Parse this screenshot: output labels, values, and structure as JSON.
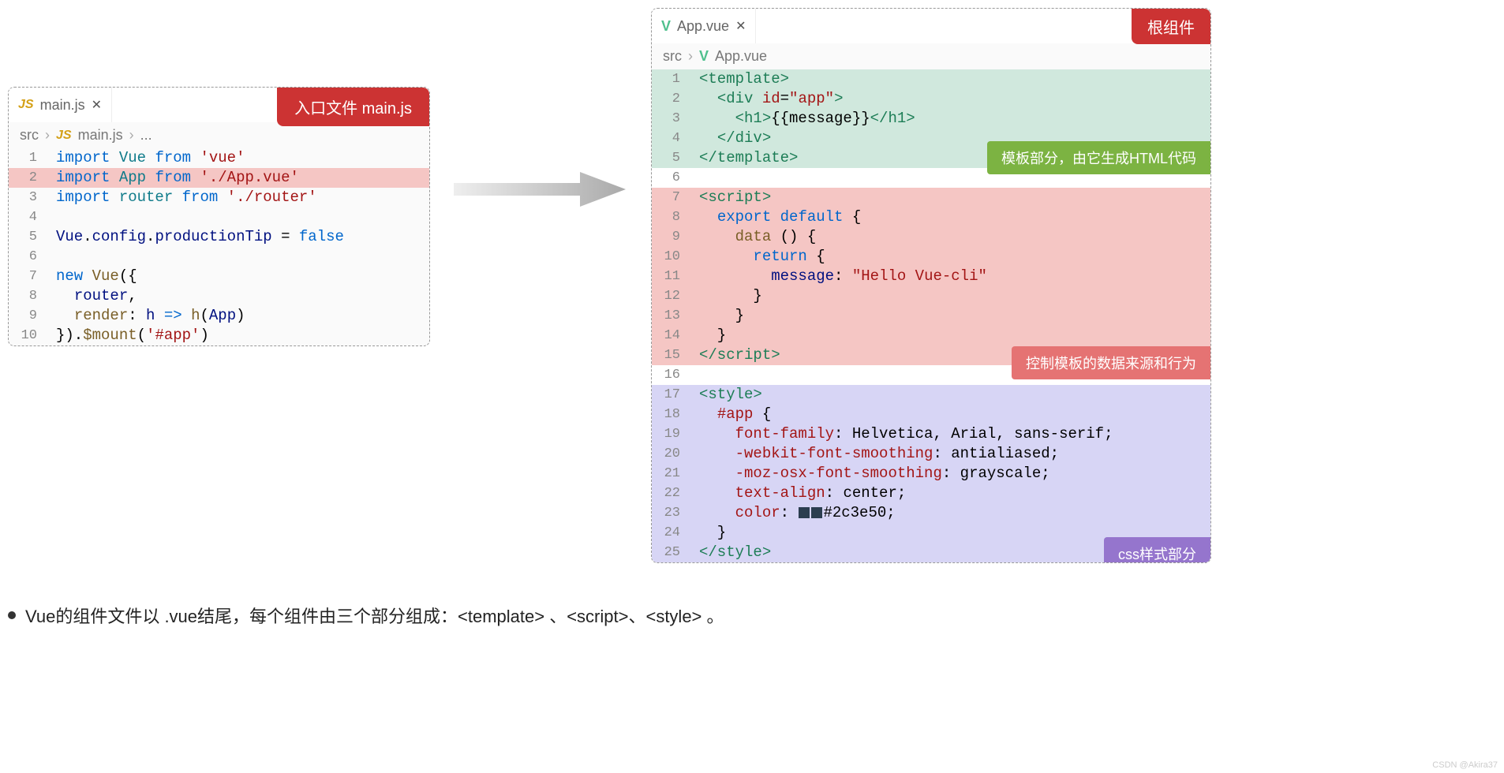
{
  "left": {
    "badge": "入口文件 main.js",
    "tab_name": "main.js",
    "tab_icon": "JS",
    "breadcrumb": {
      "seg1": "src",
      "seg2": "main.js",
      "seg3": "..."
    },
    "lines": [
      {
        "n": "1",
        "cls": "",
        "html": "<span class='kw'>import</span> <span class='var'>Vue</span> <span class='kw'>from</span> <span class='str'>'vue'</span>"
      },
      {
        "n": "2",
        "cls": "hl-highlight",
        "html": "<span class='kw'>import</span> <span class='var'>App</span> <span class='kw'>from</span> <span class='str'>'./App.vue'</span>"
      },
      {
        "n": "3",
        "cls": "",
        "html": "<span class='kw'>import</span> <span class='var'>router</span> <span class='kw'>from</span> <span class='str'>'./router'</span>"
      },
      {
        "n": "4",
        "cls": "",
        "html": ""
      },
      {
        "n": "5",
        "cls": "",
        "html": "<span class='ident'>Vue</span>.<span class='ident'>config</span>.<span class='ident'>productionTip</span> = <span class='kw'>false</span>"
      },
      {
        "n": "6",
        "cls": "",
        "html": ""
      },
      {
        "n": "7",
        "cls": "",
        "html": "<span class='kw'>new</span> <span class='fn'>Vue</span>({"
      },
      {
        "n": "8",
        "cls": "",
        "html": "  <span class='ident'>router</span>,"
      },
      {
        "n": "9",
        "cls": "",
        "html": "  <span class='fn'>render</span>: <span class='ident'>h</span> <span class='kw'>=&gt;</span> <span class='fn'>h</span>(<span class='ident'>App</span>)"
      },
      {
        "n": "10",
        "cls": "",
        "html": "}).<span class='fn'>$mount</span>(<span class='str'>'#app'</span>)"
      }
    ]
  },
  "right": {
    "badge": "根组件",
    "tab_name": "App.vue",
    "tab_icon": "V",
    "breadcrumb": {
      "seg1": "src",
      "seg2": "App.vue"
    },
    "labels": {
      "template": "模板部分，由它生成HTML代码",
      "script": "控制模板的数据来源和行为",
      "style": "css样式部分"
    },
    "lines": [
      {
        "n": "1",
        "cls": "hl-template",
        "html": "<span class='tag'>&lt;template&gt;</span>"
      },
      {
        "n": "2",
        "cls": "hl-template",
        "html": "  <span class='tag'>&lt;div</span> <span class='attr'>id</span>=<span class='str'>\"app\"</span><span class='tag'>&gt;</span>"
      },
      {
        "n": "3",
        "cls": "hl-template",
        "html": "    <span class='tag'>&lt;h1&gt;</span>{{message}}<span class='tag'>&lt;/h1&gt;</span>"
      },
      {
        "n": "4",
        "cls": "hl-template",
        "html": "  <span class='tag'>&lt;/div&gt;</span>"
      },
      {
        "n": "5",
        "cls": "hl-template",
        "html": "<span class='tag'>&lt;/template&gt;</span>"
      },
      {
        "n": "6",
        "cls": "hl-blank",
        "html": ""
      },
      {
        "n": "7",
        "cls": "hl-script",
        "html": "<span class='tag'>&lt;script&gt;</span>"
      },
      {
        "n": "8",
        "cls": "hl-script",
        "html": "  <span class='kw'>export</span> <span class='kw'>default</span> {"
      },
      {
        "n": "9",
        "cls": "hl-script",
        "html": "    <span class='fn'>data</span> () {"
      },
      {
        "n": "10",
        "cls": "hl-script",
        "html": "      <span class='kw'>return</span> {"
      },
      {
        "n": "11",
        "cls": "hl-script",
        "html": "        <span class='ident'>message</span>: <span class='str'>\"Hello Vue-cli\"</span>"
      },
      {
        "n": "12",
        "cls": "hl-script",
        "html": "      }"
      },
      {
        "n": "13",
        "cls": "hl-script",
        "html": "    }"
      },
      {
        "n": "14",
        "cls": "hl-script",
        "html": "  }"
      },
      {
        "n": "15",
        "cls": "hl-script",
        "html": "<span class='tag'>&lt;/script&gt;</span>"
      },
      {
        "n": "16",
        "cls": "hl-blank",
        "html": ""
      },
      {
        "n": "17",
        "cls": "hl-style",
        "html": "<span class='tag'>&lt;style&gt;</span>"
      },
      {
        "n": "18",
        "cls": "hl-style",
        "html": "  <span class='prop'>#app</span> {"
      },
      {
        "n": "19",
        "cls": "hl-style",
        "html": "    <span class='prop'>font-family</span>: Helvetica, Arial, sans-serif;"
      },
      {
        "n": "20",
        "cls": "hl-style",
        "html": "    <span class='prop'>-webkit-font-smoothing</span>: antialiased;"
      },
      {
        "n": "21",
        "cls": "hl-style",
        "html": "    <span class='prop'>-moz-osx-font-smoothing</span>: grayscale;"
      },
      {
        "n": "22",
        "cls": "hl-style",
        "html": "    <span class='prop'>text-align</span>: center;"
      },
      {
        "n": "23",
        "cls": "hl-style",
        "html": "    <span class='prop'>color</span>: <span class='color-swatch'></span><span class='color-swatch'></span>#2c3e50;"
      },
      {
        "n": "24",
        "cls": "hl-style",
        "html": "  }"
      },
      {
        "n": "25",
        "cls": "hl-style",
        "html": "<span class='tag'>&lt;/style&gt;</span>"
      }
    ]
  },
  "footer": "Vue的组件文件以 .vue结尾，每个组件由三个部分组成：<template> 、<script>、<style> 。",
  "watermark": "CSDN @Akira37"
}
